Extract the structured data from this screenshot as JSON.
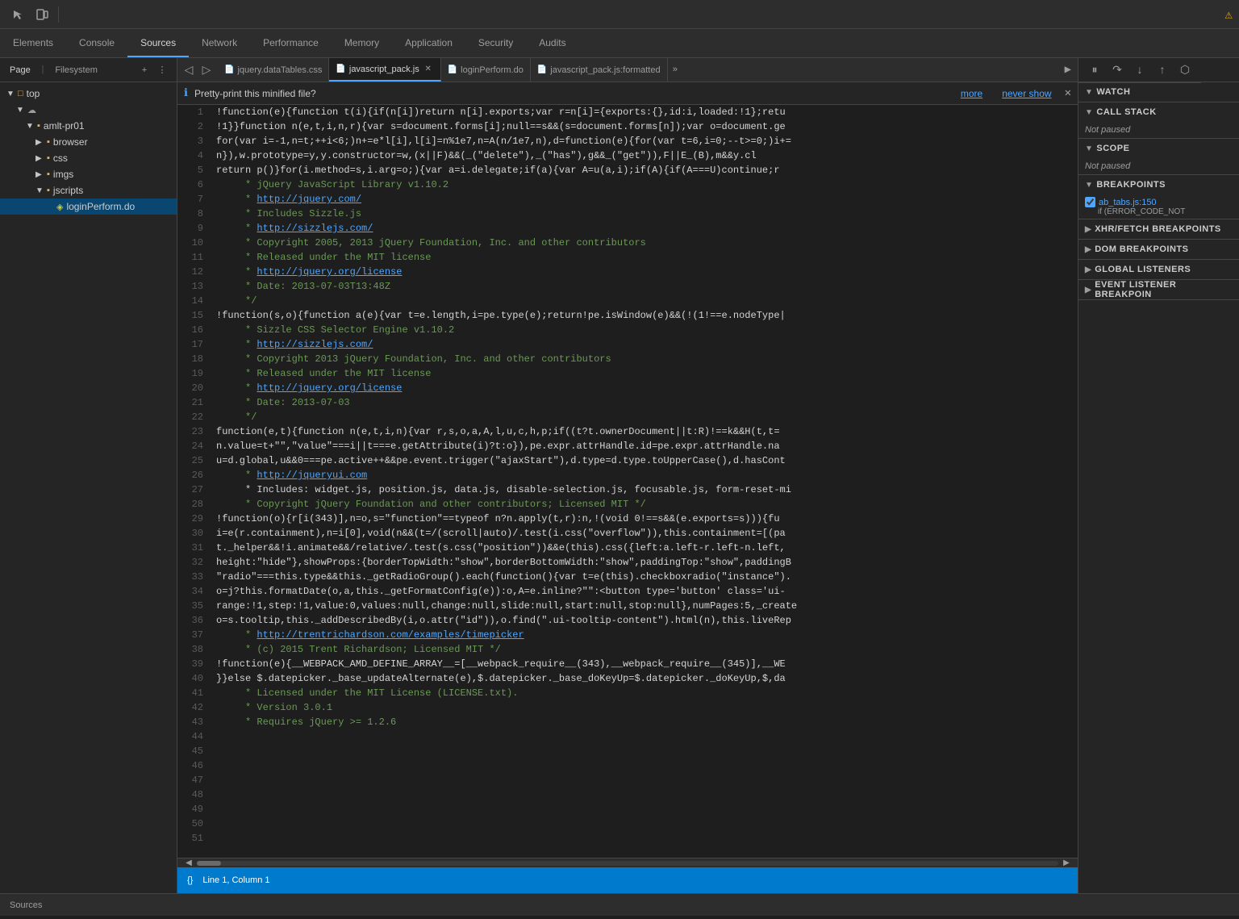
{
  "toolbar": {
    "inspect_label": "Inspect",
    "device_label": "Device"
  },
  "tabs": [
    {
      "id": "elements",
      "label": "Elements",
      "active": false
    },
    {
      "id": "console",
      "label": "Console",
      "active": false
    },
    {
      "id": "sources",
      "label": "Sources",
      "active": true
    },
    {
      "id": "network",
      "label": "Network",
      "active": false
    },
    {
      "id": "performance",
      "label": "Performance",
      "active": false
    },
    {
      "id": "memory",
      "label": "Memory",
      "active": false
    },
    {
      "id": "application",
      "label": "Application",
      "active": false
    },
    {
      "id": "security",
      "label": "Security",
      "active": false
    },
    {
      "id": "audits",
      "label": "Audits",
      "active": false
    }
  ],
  "left_panel": {
    "tabs": [
      {
        "id": "page",
        "label": "Page",
        "active": true
      },
      {
        "id": "filesystem",
        "label": "Filesystem",
        "active": false
      }
    ],
    "tree": [
      {
        "id": "top",
        "label": "top",
        "indent": 1,
        "type": "folder",
        "expanded": true,
        "arrow": "▼"
      },
      {
        "id": "cloud",
        "label": "",
        "indent": 2,
        "type": "cloud",
        "expanded": true,
        "arrow": "▼"
      },
      {
        "id": "amlt-pr01",
        "label": "amlt-pr01",
        "indent": 3,
        "type": "folder",
        "expanded": true,
        "arrow": "▼"
      },
      {
        "id": "browser",
        "label": "browser",
        "indent": 4,
        "type": "folder",
        "expanded": false,
        "arrow": "▶"
      },
      {
        "id": "css",
        "label": "css",
        "indent": 4,
        "type": "folder",
        "expanded": false,
        "arrow": "▶"
      },
      {
        "id": "imgs",
        "label": "imgs",
        "indent": 4,
        "type": "folder",
        "expanded": false,
        "arrow": "▶"
      },
      {
        "id": "jscripts",
        "label": "jscripts",
        "indent": 4,
        "type": "folder",
        "expanded": true,
        "arrow": "▼"
      },
      {
        "id": "loginPerform",
        "label": "loginPerform.do",
        "indent": 5,
        "type": "file-js",
        "expanded": false,
        "arrow": ""
      }
    ]
  },
  "editor_tabs": [
    {
      "id": "jquery-datatables",
      "label": "jquery.dataTables.css",
      "active": false,
      "closeable": false,
      "icon": "📄"
    },
    {
      "id": "javascript-pack",
      "label": "javascript_pack.js",
      "active": true,
      "closeable": true,
      "icon": "📄"
    },
    {
      "id": "login-perform",
      "label": "loginPerform.do",
      "active": false,
      "closeable": false,
      "icon": "📄"
    },
    {
      "id": "javascript-formatted",
      "label": "javascript_pack.js:formatted",
      "active": false,
      "closeable": false,
      "icon": "📄"
    }
  ],
  "pretty_print": {
    "text": "Pretty-print this minified file?",
    "more_label": "more",
    "never_show_label": "never show"
  },
  "code_lines": [
    {
      "num": 1,
      "content": "!function(e){function t(i){if(n[i])return n[i].exports;var r=n[i]={exports:{},id:i,loaded:!1};retu"
    },
    {
      "num": 2,
      "content": "!1}}function n(e,t,i,n,r){var s=document.forms[i];null==s&&(s=document.forms[n]);var o=document.ge"
    },
    {
      "num": 3,
      "content": "for(var i=-1,n=t;++i<6;)n+=e*l[i],l[i]=n%1e7,n=A(n/1e7,n),d=function(e){for(var t=6,i=0;--t>=0;)i+="
    },
    {
      "num": 4,
      "content": "n}),w.prototype=y,y.constructor=w,(x||F)&&(_(\"delete\"),_(\"has\"),g&&_(\"get\")),F||E_(B),m&&y.cl"
    },
    {
      "num": 5,
      "content": "return p()}for(i.method=s,i.arg=o;){var a=i.delegate;if(a){var A=u(a,i);if(A){if(A===U)continue;r"
    },
    {
      "num": 6,
      "content": ""
    },
    {
      "num": 7,
      "content": "     * jQuery JavaScript Library v1.10.2",
      "type": "comment"
    },
    {
      "num": 8,
      "content": "     * http://jquery.com/",
      "type": "comment",
      "url": true
    },
    {
      "num": 9,
      "content": ""
    },
    {
      "num": 10,
      "content": "     * Includes Sizzle.js",
      "type": "comment"
    },
    {
      "num": 11,
      "content": "     * http://sizzlejs.com/",
      "type": "comment",
      "url": true
    },
    {
      "num": 12,
      "content": ""
    },
    {
      "num": 13,
      "content": "     * Copyright 2005, 2013 jQuery Foundation, Inc. and other contributors",
      "type": "comment"
    },
    {
      "num": 14,
      "content": "     * Released under the MIT license",
      "type": "comment"
    },
    {
      "num": 15,
      "content": "     * http://jquery.org/license",
      "type": "comment",
      "url": true
    },
    {
      "num": 16,
      "content": ""
    },
    {
      "num": 17,
      "content": "     * Date: 2013-07-03T13:48Z",
      "type": "comment"
    },
    {
      "num": 18,
      "content": "     */",
      "type": "comment"
    },
    {
      "num": 19,
      "content": "!function(s,o){function a(e){var t=e.length,i=pe.type(e);return!pe.isWindow(e)&&(!(1!==e.nodeType|"
    },
    {
      "num": 20,
      "content": "     * Sizzle CSS Selector Engine v1.10.2",
      "type": "comment"
    },
    {
      "num": 21,
      "content": "     * http://sizzlejs.com/",
      "type": "comment",
      "url": true
    },
    {
      "num": 22,
      "content": ""
    },
    {
      "num": 23,
      "content": "     * Copyright 2013 jQuery Foundation, Inc. and other contributors",
      "type": "comment"
    },
    {
      "num": 24,
      "content": "     * Released under the MIT license",
      "type": "comment"
    },
    {
      "num": 25,
      "content": "     * http://jquery.org/license",
      "type": "comment",
      "url": true
    },
    {
      "num": 26,
      "content": ""
    },
    {
      "num": 27,
      "content": "     * Date: 2013-07-03",
      "type": "comment"
    },
    {
      "num": 28,
      "content": "     */",
      "type": "comment"
    },
    {
      "num": 29,
      "content": "function(e,t){function n(e,t,i,n){var r,s,o,a,A,l,u,c,h,p;if((t?t.ownerDocument||t:R)!==k&&H(t,t="
    },
    {
      "num": 30,
      "content": "n.value=t+\"\",\"value\"===i||t===e.getAttribute(i)?t:o}),pe.expr.attrHandle.id=pe.expr.attrHandle.na"
    },
    {
      "num": 31,
      "content": "u=d.global,u&&0===pe.active++&&pe.event.trigger(\"ajaxStart\"),d.type=d.type.toUpperCase(),d.hasCont"
    },
    {
      "num": 32,
      "content": "     * http://jqueryui.com",
      "type": "comment",
      "url": true
    },
    {
      "num": 33,
      "content": "     * Includes: widget.js, position.js, data.js, disable-selection.js, focusable.js, form-reset-mi"
    },
    {
      "num": 34,
      "content": "     * Copyright jQuery Foundation and other contributors; Licensed MIT */",
      "type": "comment"
    },
    {
      "num": 35,
      "content": "!function(o){r[i(343)],n=o,s=\"function\"==typeof n?n.apply(t,r):n,!(void 0!==s&&(e.exports=s))){fu"
    },
    {
      "num": 36,
      "content": "i=e(r.containment),n=i[0],void(n&&(t=/(scroll|auto)/.test(i.css(\"overflow\")),this.containment=[(pa"
    },
    {
      "num": 37,
      "content": "t._helper&&!i.animate&&/relative/.test(s.css(\"position\"))&&e(this).css({left:a.left-r.left-n.left,"
    },
    {
      "num": 38,
      "content": "height:\"hide\"},showProps:{borderTopWidth:\"show\",borderBottomWidth:\"show\",paddingTop:\"show\",paddingB"
    },
    {
      "num": 39,
      "content": "\"radio\"===this.type&&this._getRadioGroup().each(function(){var t=e(this).checkboxradio(\"instance\")."
    },
    {
      "num": 40,
      "content": "o=j?this.formatDate(o,a,this._getFormatConfig(e)):o,A=e.inline?\"\":<button type='button' class='ui-"
    },
    {
      "num": 41,
      "content": "range:!1,step:!1,value:0,values:null,change:null,slide:null,start:null,stop:null},numPages:5,_create"
    },
    {
      "num": 42,
      "content": "o=s.tooltip,this._addDescribedBy(i,o.attr(\"id\")),o.find(\".ui-tooltip-content\").html(n),this.liveRep"
    },
    {
      "num": 43,
      "content": "     * http://trentrichardson.com/examples/timepicker",
      "type": "comment",
      "url": true
    },
    {
      "num": 44,
      "content": "     * (c) 2015 Trent Richardson; Licensed MIT */",
      "type": "comment"
    },
    {
      "num": 45,
      "content": "!function(e){__WEBPACK_AMD_DEFINE_ARRAY__=[__webpack_require__(343),__webpack_require__(345)],__WE"
    },
    {
      "num": 46,
      "content": "}}else $.datepicker._base_updateAlternate(e),$.datepicker._base_doKeyUp=$.datepicker._doKeyUp,$,da"
    },
    {
      "num": 47,
      "content": "     * Licensed under the MIT License (LICENSE.txt).",
      "type": "comment"
    },
    {
      "num": 48,
      "content": ""
    },
    {
      "num": 49,
      "content": "     * Version 3.0.1",
      "type": "comment"
    },
    {
      "num": 50,
      "content": ""
    },
    {
      "num": 51,
      "content": "     * Requires jQuery >= 1.2.6",
      "type": "comment"
    }
  ],
  "right_panel": {
    "debugger_buttons": [
      "pause",
      "resume",
      "step-over",
      "step-into",
      "step-out",
      "deactivate"
    ],
    "watch": {
      "label": "Watch",
      "expanded": true
    },
    "call_stack": {
      "label": "Call Stack",
      "expanded": true,
      "status": "Not paused"
    },
    "scope": {
      "label": "Scope",
      "expanded": true,
      "status": "Not paused"
    },
    "breakpoints": {
      "label": "Breakpoints",
      "expanded": true,
      "items": [
        {
          "filename": "ab_tabs.js:150",
          "condition": "if (ERROR_CODE_NOT"
        }
      ]
    },
    "xhr_breakpoints": {
      "label": "XHR/fetch Breakpoints",
      "expanded": false
    },
    "dom_breakpoints": {
      "label": "DOM Breakpoints",
      "expanded": false
    },
    "global_listeners": {
      "label": "Global Listeners",
      "expanded": false
    },
    "event_listener_breakpoints": {
      "label": "Event Listener Breakpoin",
      "expanded": false
    }
  },
  "status_bar": {
    "position": "Line 1, Column 1",
    "icon_label": "{}"
  },
  "bottom_log": "Sources",
  "warning_icon": "⚠"
}
